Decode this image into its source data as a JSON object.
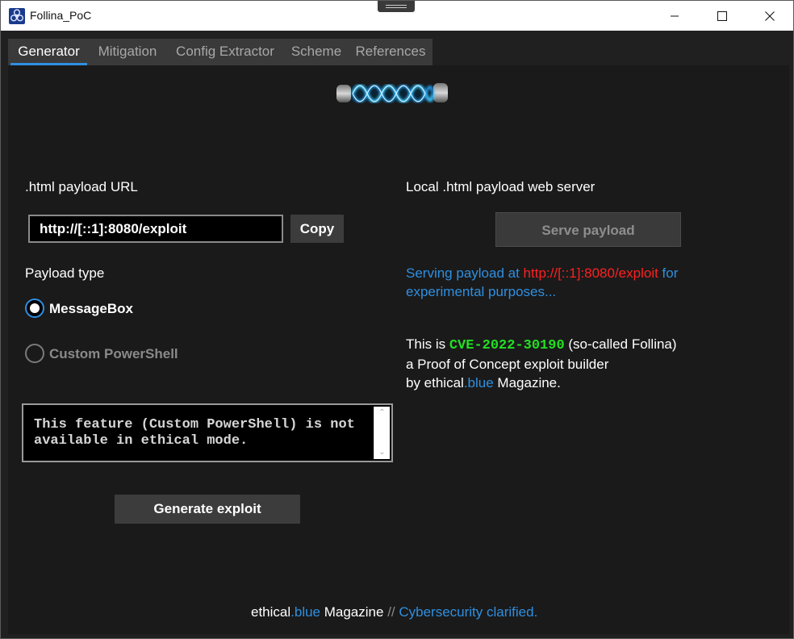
{
  "window": {
    "title": "Follina_PoC"
  },
  "tabs": [
    "Generator",
    "Mitigation",
    "Config Extractor",
    "Scheme",
    "References"
  ],
  "generator": {
    "url_label": ".html payload URL",
    "url_value": "http://[::1]:8080/exploit",
    "copy_label": "Copy",
    "payload_type_label": "Payload type",
    "option_messagebox": "MessageBox",
    "option_powershell": "Custom PowerShell",
    "notice_text": "This feature (Custom PowerShell) is not available in ethical mode.",
    "generate_label": "Generate exploit"
  },
  "server": {
    "title": "Local .html payload web server",
    "serve_label": "Serve payload",
    "status_prefix": "Serving payload at ",
    "status_url": "http://[::1]:8080/exploit",
    "status_suffix_1": " for",
    "status_suffix_2": "experimental purposes..."
  },
  "about": {
    "line1_prefix": "This is ",
    "cve": "CVE-2022-30190",
    "line1_suffix": " (so-called Follina)",
    "line2": "a Proof of Concept exploit builder",
    "line3_prefix": "by ethical",
    "line3_blue": ".blue",
    "line3_suffix": " Magazine."
  },
  "footer": {
    "part1": "ethical",
    "part2": ".blue",
    "part3": " Magazine ",
    "part4": "//",
    "part5": " Cybersecurity clarified."
  },
  "colors": {
    "accent": "#2f8fe0",
    "danger": "#ff2020",
    "cve": "#22e022",
    "background": "#1a1a1a"
  },
  "icons": {
    "app": "biohazard-icon",
    "logo": "glowing-dna-tube"
  }
}
